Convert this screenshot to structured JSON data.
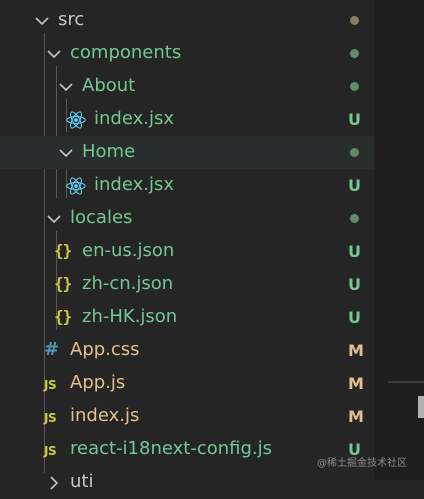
{
  "colors": {
    "untracked": "#73c991",
    "modified": "#e2c08d",
    "folder_dot_src": "#8c7b5e",
    "folder_dot_green": "#73c991",
    "json_icon": "#cbcb41",
    "js_icon": "#cbcb41",
    "css_icon": "#519aba",
    "react_icon": "#61dafb"
  },
  "tree": {
    "src": {
      "label": "src"
    },
    "components": {
      "label": "components"
    },
    "about_folder": {
      "label": "About"
    },
    "about_index": {
      "label": "index.jsx",
      "badge": "U"
    },
    "home_folder": {
      "label": "Home"
    },
    "home_index": {
      "label": "index.jsx",
      "badge": "U"
    },
    "locales": {
      "label": "locales"
    },
    "en_us": {
      "label": "en-us.json",
      "badge": "U",
      "icon": "{}"
    },
    "zh_cn": {
      "label": "zh-cn.json",
      "badge": "U",
      "icon": "{}"
    },
    "zh_hk": {
      "label": "zh-HK.json",
      "badge": "U",
      "icon": "{}"
    },
    "app_css": {
      "label": "App.css",
      "badge": "M",
      "icon": "#"
    },
    "app_js": {
      "label": "App.js",
      "badge": "M",
      "icon": "JS"
    },
    "index_js": {
      "label": "index.js",
      "badge": "M",
      "icon": "JS"
    },
    "react_i18next": {
      "label": "react-i18next-config.js",
      "badge": "U",
      "icon": "JS"
    },
    "partial": {
      "label": "uti"
    }
  },
  "watermark": "@稀土掘金技术社区"
}
